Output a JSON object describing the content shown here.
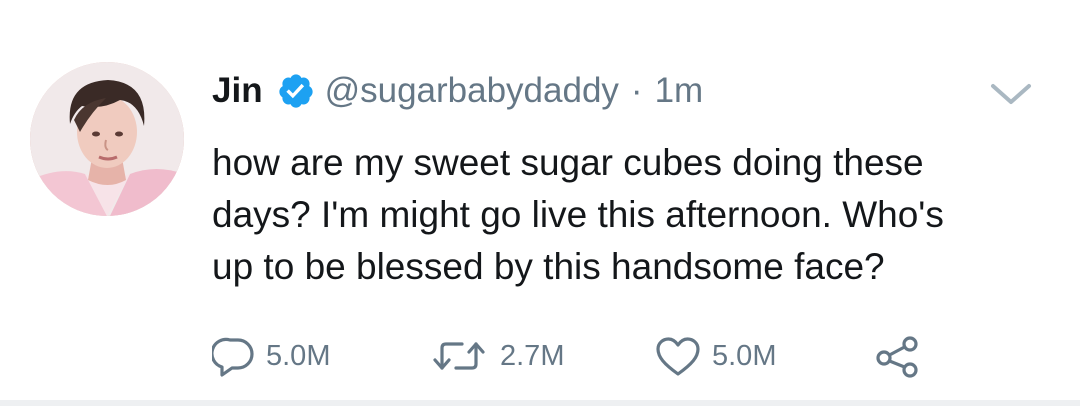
{
  "tweet": {
    "display_name": "Jin",
    "handle": "@sugarbabydaddy",
    "separator": "·",
    "time": "1m",
    "text_lines": [
      "how are my sweet sugar cubes doing these",
      "days? I'm might go live this afternoon. Who's",
      "up to be blessed by this handsome face?"
    ],
    "actions": {
      "reply_count": "5.0M",
      "retweet_count": "2.7M",
      "like_count": "5.0M"
    },
    "icons": {
      "avatar": "profile-photo",
      "verified": "verified-badge-icon",
      "menu": "chevron-down-icon",
      "reply": "reply-icon",
      "retweet": "retweet-icon",
      "like": "heart-icon",
      "share": "share-icon"
    },
    "colors": {
      "text": "#14171a",
      "secondary": "#657786",
      "verified": "#1da1f2"
    }
  }
}
